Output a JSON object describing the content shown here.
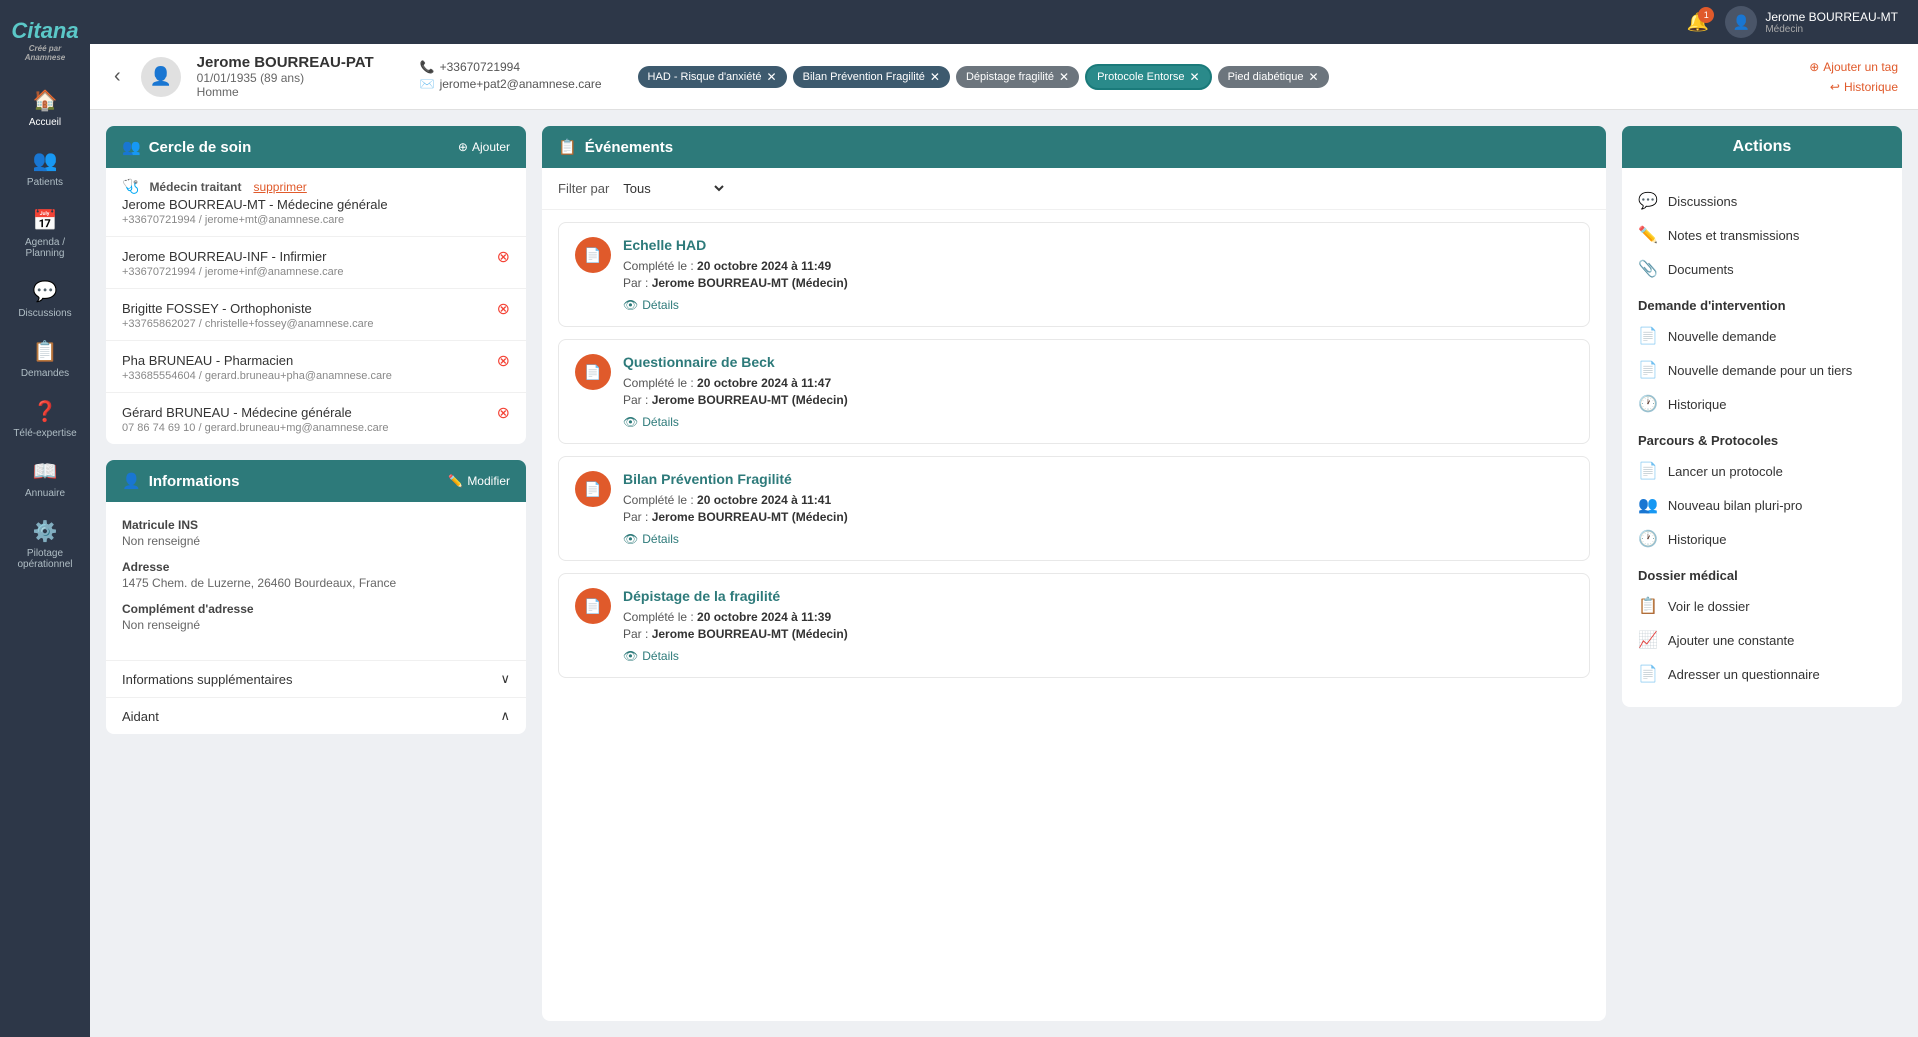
{
  "app": {
    "name": "Citana",
    "sub": "Créé par Anamnese"
  },
  "topbar": {
    "notification_count": "1",
    "user_name": "Jerome BOURREAU-MT",
    "user_role": "Médecin"
  },
  "patient": {
    "name": "Jerome BOURREAU-PAT",
    "dob": "01/01/1935 (89 ans)",
    "gender": "Homme",
    "phone": "+33670721994",
    "email": "jerome+pat2@anamnese.care",
    "tags": [
      {
        "label": "HAD - Risque d'anxiété",
        "style": "dark"
      },
      {
        "label": "Bilan Prévention Fragilité",
        "style": "dark"
      },
      {
        "label": "Dépistage fragilité",
        "style": "gray"
      },
      {
        "label": "Protocole Entorse",
        "style": "teal"
      },
      {
        "label": "Pied diabétique",
        "style": "gray"
      }
    ],
    "add_tag": "Ajouter un tag",
    "historique": "Historique"
  },
  "sidebar": {
    "items": [
      {
        "label": "Accueil",
        "icon": "🏠"
      },
      {
        "label": "Patients",
        "icon": "👥"
      },
      {
        "label": "Agenda / Planning",
        "icon": "📅"
      },
      {
        "label": "Discussions",
        "icon": "💬"
      },
      {
        "label": "Demandes",
        "icon": "📋"
      },
      {
        "label": "Télé-expertise",
        "icon": "❓"
      },
      {
        "label": "Annuaire",
        "icon": "📖"
      },
      {
        "label": "Pilotage opérationnel",
        "icon": "⚙️"
      }
    ]
  },
  "care_circle": {
    "title": "Cercle de soin",
    "add_label": "Ajouter",
    "members": [
      {
        "role": "Médecin traitant",
        "action": "supprimer",
        "name": "Jerome BOURREAU-MT - Médecine générale",
        "contact": "+33670721994 / jerome+mt@anamnese.care",
        "is_main": true
      },
      {
        "role": "Infirmier",
        "name": "Jerome BOURREAU-INF - Infirmier",
        "contact": "+33670721994 / jerome+inf@anamnese.care"
      },
      {
        "role": "Orthophoniste",
        "name": "Brigitte FOSSEY - Orthophoniste",
        "contact": "+33765862027 / christelle+fossey@anamnese.care"
      },
      {
        "role": "Pharmacien",
        "name": "Pha BRUNEAU - Pharmacien",
        "contact": "+33685554604 / gerard.bruneau+pha@anamnese.care"
      },
      {
        "role": "Médecine générale",
        "name": "Gérard BRUNEAU - Médecine générale",
        "contact": "07 86 74 69 10 / gerard.bruneau+mg@anamnese.care"
      }
    ]
  },
  "informations": {
    "title": "Informations",
    "modify_label": "Modifier",
    "fields": [
      {
        "label": "Matricule INS",
        "value": "Non renseigné"
      },
      {
        "label": "Adresse",
        "value": "1475 Chem. de Luzerne, 26460 Bourdeaux, France"
      },
      {
        "label": "Complément d'adresse",
        "value": "Non renseigné"
      }
    ],
    "collapsibles": [
      {
        "label": "Informations supplémentaires",
        "expanded": false
      },
      {
        "label": "Aidant",
        "expanded": true
      }
    ]
  },
  "events": {
    "title": "Événements",
    "filter_label": "Filter par",
    "filter_value": "Tous",
    "items": [
      {
        "title": "Echelle HAD",
        "completed_label": "Complété le :",
        "completed_date": "20 octobre 2024 à 11:49",
        "by_label": "Par :",
        "by_value": "Jerome BOURREAU-MT (Médecin)",
        "details": "Détails"
      },
      {
        "title": "Questionnaire de Beck",
        "completed_label": "Complété le :",
        "completed_date": "20 octobre 2024 à 11:47",
        "by_label": "Par :",
        "by_value": "Jerome BOURREAU-MT (Médecin)",
        "details": "Détails"
      },
      {
        "title": "Bilan Prévention Fragilité",
        "completed_label": "Complété le :",
        "completed_date": "20 octobre 2024 à 11:41",
        "by_label": "Par :",
        "by_value": "Jerome BOURREAU-MT (Médecin)",
        "details": "Détails"
      },
      {
        "title": "Dépistage de la fragilité",
        "completed_label": "Complété le :",
        "completed_date": "20 octobre 2024 à 11:39",
        "by_label": "Par :",
        "by_value": "Jerome BOURREAU-MT (Médecin)",
        "details": "Détails"
      }
    ]
  },
  "actions": {
    "title": "Actions",
    "sections": [
      {
        "items": [
          {
            "label": "Discussions",
            "icon": "💬",
            "color": "orange"
          },
          {
            "label": "Notes et transmissions",
            "icon": "✏️",
            "color": "orange"
          },
          {
            "label": "Documents",
            "icon": "📎",
            "color": "orange"
          }
        ]
      },
      {
        "title": "Demande d'intervention",
        "items": [
          {
            "label": "Nouvelle demande",
            "icon": "📄",
            "color": "red"
          },
          {
            "label": "Nouvelle demande pour un tiers",
            "icon": "📄",
            "color": "red"
          },
          {
            "label": "Historique",
            "icon": "🕐",
            "color": "orange"
          }
        ]
      },
      {
        "title": "Parcours & Protocoles",
        "items": [
          {
            "label": "Lancer un protocole",
            "icon": "📄",
            "color": "red"
          },
          {
            "label": "Nouveau bilan pluri-pro",
            "icon": "👥",
            "color": "orange"
          },
          {
            "label": "Historique",
            "icon": "🕐",
            "color": "orange"
          }
        ]
      },
      {
        "title": "Dossier médical",
        "items": [
          {
            "label": "Voir le dossier",
            "icon": "📋",
            "color": "red"
          },
          {
            "label": "Ajouter une constante",
            "icon": "📈",
            "color": "orange"
          },
          {
            "label": "Adresser un questionnaire",
            "icon": "📄",
            "color": "red"
          }
        ]
      }
    ]
  }
}
